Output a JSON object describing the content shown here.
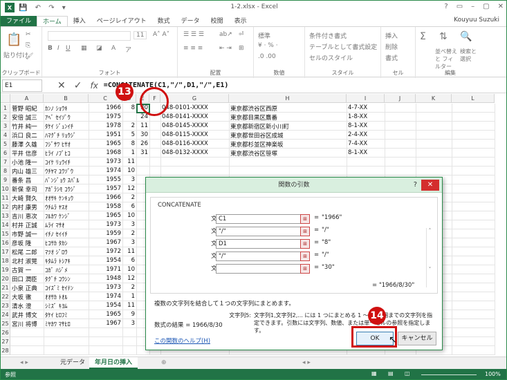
{
  "app": {
    "window_title": "1-2.xlsx - Excel",
    "logo_text": "X",
    "user_name": "Kouyuu Suzuki",
    "window_controls": [
      "?",
      "▭",
      "–",
      "▢",
      "✕"
    ]
  },
  "ribbon_tabs": [
    {
      "label": "ファイル",
      "state": "file"
    },
    {
      "label": "ホーム",
      "state": "active"
    },
    {
      "label": "挿入"
    },
    {
      "label": "ページレイアウト"
    },
    {
      "label": "数式"
    },
    {
      "label": "データ"
    },
    {
      "label": "校閲"
    },
    {
      "label": "表示"
    }
  ],
  "ribbon_groups": [
    {
      "label": "クリップボード"
    },
    {
      "label": "フォント"
    },
    {
      "label": "配置"
    },
    {
      "label": "数値"
    },
    {
      "label": "スタイル"
    },
    {
      "label": "セル"
    },
    {
      "label": "編集"
    }
  ],
  "ribbon_items": {
    "paste": "貼り付け",
    "font_size": "11",
    "number_format": "標準",
    "conditional": "条件付き書式",
    "as_table": "テーブルとして書式設定",
    "cell_style": "セルのスタイル",
    "insert": "挿入",
    "delete": "削除",
    "format": "書式",
    "sort_filter": "並べ替えと フィルター",
    "find_select": "検索と 選択"
  },
  "formula_bar": {
    "name_box": "E1",
    "fx": "fx",
    "formula": "=CONCATENATE(C1,\"/\",D1,\"/\",E1)"
  },
  "columns": [
    "A",
    "B",
    "C",
    "D",
    "E",
    "F",
    "G",
    "H",
    "I",
    "J",
    "K",
    "L"
  ],
  "rows": [
    {
      "n": "1",
      "a": "菅野 昭紀",
      "b": "ｶﾝﾉ ｼｮｳｷ",
      "c": "1966",
      "d": "8",
      "e": "30",
      "f": "",
      "g": "048-0101-XXXX",
      "h": "東京都渋谷区西原",
      "i": "4-7-XX"
    },
    {
      "n": "2",
      "a": "安倍 誠三",
      "b": "ｱﾍﾞ ｾｲｿﾞｳ",
      "c": "1975",
      "d": "",
      "e": "24",
      "f": "",
      "g": "048-0141-XXXX",
      "h": "東京都目黒区鷹番",
      "i": "1-8-XX"
    },
    {
      "n": "3",
      "a": "竹井 純一",
      "b": "ﾀｹｲ ｼﾞｭﾝｲﾁ",
      "c": "1978",
      "d": "2",
      "e": "11",
      "f": "",
      "g": "048-0145-XXXX",
      "h": "東京都新宿区新小川町",
      "i": "8-1-XX"
    },
    {
      "n": "4",
      "a": "浜口 良二",
      "b": "ﾊﾏｸﾞﾁ ﾘｮｳｼﾞ",
      "c": "1951",
      "d": "5",
      "e": "30",
      "f": "",
      "g": "048-0115-XXXX",
      "h": "東京都世田谷区成城",
      "i": "2-4-XX"
    },
    {
      "n": "5",
      "a": "藤澤 久雄",
      "b": "ﾌｼﾞｻﾜ ﾋｻｵ",
      "c": "1965",
      "d": "8",
      "e": "26",
      "f": "",
      "g": "048-0116-XXXX",
      "h": "東京都杉並区神楽坂",
      "i": "7-4-XX"
    },
    {
      "n": "6",
      "a": "平井 信彦",
      "b": "ﾋﾗｲ ﾉﾌﾞﾋｺ",
      "c": "1968",
      "d": "1",
      "e": "31",
      "f": "",
      "g": "048-0132-XXXX",
      "h": "東京都渋谷区笹塚",
      "i": "8-1-XX"
    },
    {
      "n": "7",
      "a": "小池 隆一",
      "b": "ｺｲｹ ﾘｭｳｲﾁ",
      "c": "1973",
      "d": "11",
      "e": "",
      "f": "",
      "g": "",
      "h": "",
      "i": ""
    },
    {
      "n": "8",
      "a": "内山 雄三",
      "b": "ｳﾁﾔﾏ ﾕｳｿﾞｳ",
      "c": "1974",
      "d": "10",
      "e": "",
      "f": "",
      "g": "",
      "h": "",
      "i": ""
    },
    {
      "n": "9",
      "a": "番条 昌",
      "b": "ﾊﾞﾝｼﾞｮｳ ｽﾊﾞﾙ",
      "c": "1955",
      "d": "3",
      "e": "",
      "f": "",
      "g": "",
      "h": "",
      "i": ""
    },
    {
      "n": "10",
      "a": "新保 幸司",
      "b": "ｱｶﾞﾗｼﾓ ｺｳｼﾞ",
      "c": "1957",
      "d": "12",
      "e": "",
      "f": "",
      "g": "",
      "h": "",
      "i": ""
    },
    {
      "n": "11",
      "a": "大崎 賢久",
      "b": "ｵｵｻｷ ｹﾝｷｭｳ",
      "c": "1966",
      "d": "2",
      "e": "",
      "f": "",
      "g": "",
      "h": "",
      "i": ""
    },
    {
      "n": "12",
      "a": "内村 康男",
      "b": "ｳﾁﾑﾗ ﾔｽｵ",
      "c": "1958",
      "d": "6",
      "e": "",
      "f": "",
      "g": "",
      "h": "",
      "i": ""
    },
    {
      "n": "13",
      "a": "吉川 恵次",
      "b": "ﾌﾙｶﾜ ｹﾝｼﾞ",
      "c": "1965",
      "d": "10",
      "e": "",
      "f": "",
      "g": "",
      "h": "",
      "i": ""
    },
    {
      "n": "14",
      "a": "村井 正誠",
      "b": "ﾑﾗｲ ﾏｻｵ",
      "c": "1973",
      "d": "3",
      "e": "",
      "f": "",
      "g": "",
      "h": "",
      "i": ""
    },
    {
      "n": "15",
      "a": "市野 誠一",
      "b": "ｲﾁﾉ ｾｲｲﾁ",
      "c": "1959",
      "d": "2",
      "e": "",
      "f": "",
      "g": "",
      "h": "",
      "i": ""
    },
    {
      "n": "16",
      "a": "彦坂 隆",
      "b": "ﾋｺｻｶ ﾀｶｼ",
      "c": "1967",
      "d": "3",
      "e": "",
      "f": "",
      "g": "",
      "h": "",
      "i": ""
    },
    {
      "n": "17",
      "a": "松尾 二郎",
      "b": "ﾏﾂｵ ｼﾞﾛｳ",
      "c": "1972",
      "d": "11",
      "e": "",
      "f": "",
      "g": "",
      "h": "",
      "i": ""
    },
    {
      "n": "18",
      "a": "北村 淑晃",
      "b": "ｷﾀﾑﾗ ﾄｼｱｷ",
      "c": "1954",
      "d": "6",
      "e": "",
      "f": "",
      "g": "",
      "h": "",
      "i": ""
    },
    {
      "n": "19",
      "a": "古賀 一",
      "b": "ｺｶﾞ ﾊｼﾞﾒ",
      "c": "1971",
      "d": "10",
      "e": "",
      "f": "",
      "g": "",
      "h": "",
      "i": ""
    },
    {
      "n": "20",
      "a": "田口 潤臣",
      "b": "ﾀｸﾞﾁ ｺｳｼﾝ",
      "c": "1948",
      "d": "12",
      "e": "",
      "f": "",
      "g": "",
      "h": "",
      "i": ""
    },
    {
      "n": "21",
      "a": "小泉 正典",
      "b": "ｺｲｽﾞﾐ ｾｲﾃﾝ",
      "c": "1973",
      "d": "2",
      "e": "",
      "f": "",
      "g": "",
      "h": "",
      "i": ""
    },
    {
      "n": "22",
      "a": "大坂 徹",
      "b": "ｵｵｻｶ ﾄｵﾙ",
      "c": "1974",
      "d": "1",
      "e": "",
      "f": "",
      "g": "",
      "h": "",
      "i": ""
    },
    {
      "n": "23",
      "a": "清水 澄",
      "b": "ｼﾐｽﾞ ｷﾖﾑ",
      "c": "1954",
      "d": "11",
      "e": "",
      "f": "",
      "g": "",
      "h": "",
      "i": ""
    },
    {
      "n": "24",
      "a": "武井 博文",
      "b": "ﾀｹｲ ﾋﾛﾌﾐ",
      "c": "1965",
      "d": "9",
      "e": "",
      "f": "",
      "g": "",
      "h": "",
      "i": ""
    },
    {
      "n": "25",
      "a": "宮川 将博",
      "b": "ﾐﾔｶﾜ ﾏｻﾋﾛ",
      "c": "1967",
      "d": "3",
      "e": "",
      "f": "",
      "g": "",
      "h": "",
      "i": ""
    },
    {
      "n": "26",
      "a": "",
      "b": "",
      "c": "",
      "d": "",
      "e": "",
      "f": "",
      "g": "",
      "h": "",
      "i": ""
    },
    {
      "n": "27",
      "a": "",
      "b": "",
      "c": "",
      "d": "",
      "e": "",
      "f": "",
      "g": "",
      "h": "",
      "i": ""
    },
    {
      "n": "28",
      "a": "",
      "b": "",
      "c": "",
      "d": "",
      "e": "",
      "f": "",
      "g": "",
      "h": "",
      "i": ""
    }
  ],
  "dialog": {
    "title": "関数の引数",
    "help_q": "?",
    "close": "✕",
    "function_name": "CONCATENATE",
    "args": [
      {
        "label": "文字列1",
        "value": "C1",
        "result": "\"1966\""
      },
      {
        "label": "文字列2",
        "value": "\"/\"",
        "result": "\"/\""
      },
      {
        "label": "文字列3",
        "value": "D1",
        "result": "\"8\""
      },
      {
        "label": "文字列4",
        "value": "\"/\"",
        "result": "\"/\""
      },
      {
        "label": "文字列5",
        "value": "",
        "result": "\"30\""
      }
    ],
    "eq": "=",
    "total_result": "= \"1966/8/30\"",
    "description": "複数の文字列を結合して１つの文字列にまとめます。",
    "arg_desc_label": "文字列5:",
    "arg_desc": "文字列1,文字列2,... には 1 つにまとめる 1 ～ 255 個までの文字列を指定できます。引数には文字列、数値、または単一セルの参照を指定します。",
    "formula_result": "数式の結果 =  1966/8/30",
    "help_link": "この関数のヘルプ(H)",
    "ok": "OK",
    "cancel": "キャンセル"
  },
  "annotations": {
    "step13": "13",
    "step14": "14"
  },
  "sheet_tabs": [
    {
      "label": "元データ"
    },
    {
      "label": "年月日の挿入",
      "active": true
    }
  ],
  "status": {
    "mode": "参照",
    "zoom": "100%"
  },
  "colors": {
    "excel_green": "#217346",
    "annotation_red": "#d01010",
    "dialog_title_bg": "#d9efdf"
  }
}
